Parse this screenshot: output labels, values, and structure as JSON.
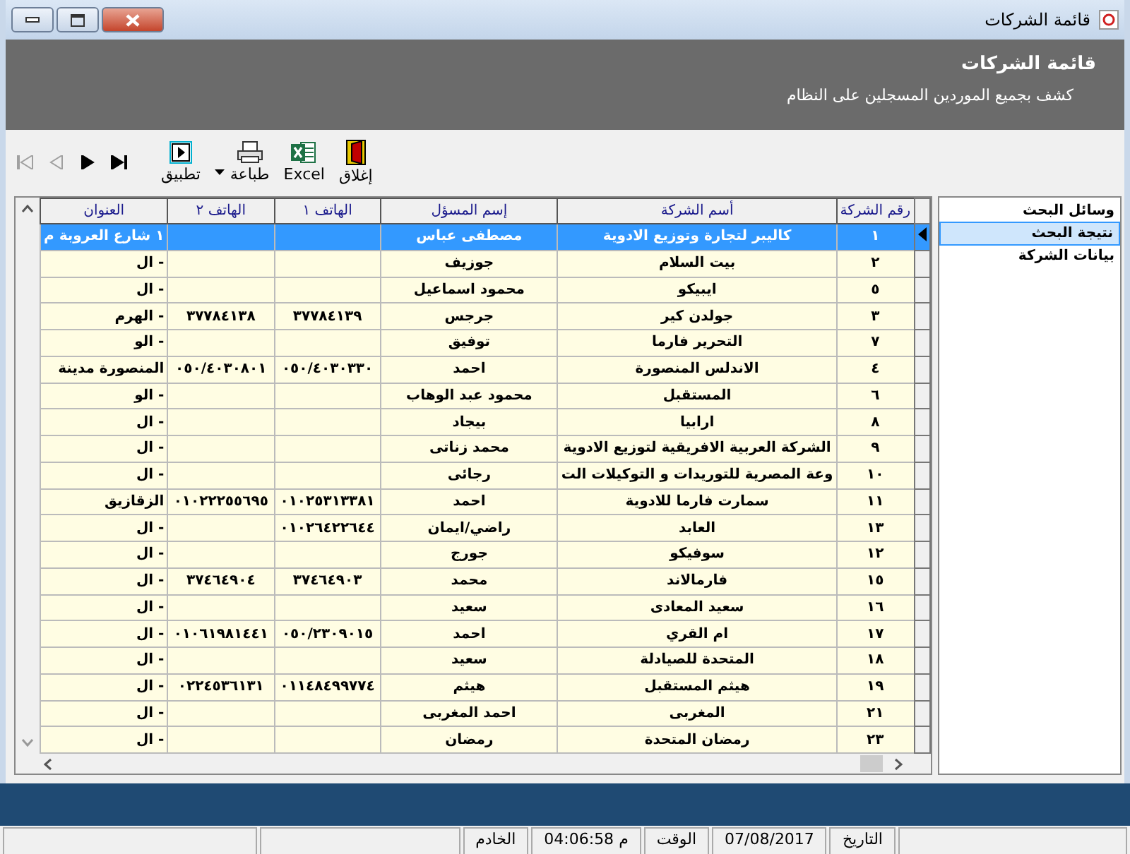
{
  "window": {
    "title": "قائمة الشركات"
  },
  "header": {
    "title": "قائمة الشركات",
    "subtitle": "كشف بجميع الموردين المسجلين على النظام"
  },
  "toolbar": {
    "nav": [
      {
        "kind": "first",
        "disabled": true
      },
      {
        "kind": "prev",
        "disabled": true
      },
      {
        "kind": "next",
        "disabled": false
      },
      {
        "kind": "last",
        "disabled": false
      }
    ],
    "buttons": [
      {
        "kind": "close",
        "label": "إغلاق"
      },
      {
        "kind": "excel",
        "label": "Excel"
      },
      {
        "kind": "print",
        "label": "طباعة"
      },
      {
        "kind": "apply",
        "label": "تطبيق"
      }
    ]
  },
  "sidebar": {
    "items": [
      {
        "label": "وسائل البحث",
        "selected": false
      },
      {
        "label": "نتيجة البحث",
        "selected": true
      },
      {
        "label": "بيانات الشركة",
        "selected": false
      }
    ]
  },
  "table": {
    "columns": [
      "رقم الشركة",
      "أسم الشركة",
      "إسم المسؤل",
      "الهاتف ١",
      "الهاتف ٢",
      "العنوان"
    ],
    "rows": [
      {
        "selected": true,
        "cells": [
          "١",
          "كاليبر لتجارة وتوزيع الادوية",
          "مصطفى عباس",
          "",
          "",
          "١ شارع العروبة م"
        ]
      },
      {
        "selected": false,
        "cells": [
          "٢",
          "بيت السلام",
          "جوزيف",
          "",
          "",
          "- ال"
        ]
      },
      {
        "selected": false,
        "cells": [
          "٥",
          "ايبيكو",
          "محمود اسماعيل",
          "",
          "",
          "- ال"
        ]
      },
      {
        "selected": false,
        "cells": [
          "٣",
          "جولدن كير",
          "جرجس",
          "٣٧٧٨٤١٣٩",
          "٣٧٧٨٤١٣٨",
          "- الهرم"
        ]
      },
      {
        "selected": false,
        "cells": [
          "٧",
          "التحرير فارما",
          "توفيق",
          "",
          "",
          "- الو"
        ]
      },
      {
        "selected": false,
        "cells": [
          "٤",
          "الاندلس المنصورة",
          "احمد",
          "٠٥٠/٤٠٣٠٣٣٠",
          "٠٥٠/٤٠٣٠٨٠١",
          "المنصورة مدينة"
        ]
      },
      {
        "selected": false,
        "cells": [
          "٦",
          "المستقبل",
          "محمود عبد الوهاب",
          "",
          "",
          "- الو"
        ]
      },
      {
        "selected": false,
        "cells": [
          "٨",
          "ارابيا",
          "بيجاد",
          "",
          "",
          "- ال"
        ]
      },
      {
        "selected": false,
        "cells": [
          "٩",
          "الشركة العربية الافريقية لتوزيع الادوية",
          "محمد زناتى",
          "",
          "",
          "- ال"
        ]
      },
      {
        "selected": false,
        "cells": [
          "١٠",
          "وعة المصرية للتوريدات و التوكيلات الت",
          "رجائى",
          "",
          "",
          "- ال"
        ]
      },
      {
        "selected": false,
        "cells": [
          "١١",
          "سمارت فارما للادوية",
          "احمد",
          "٠١٠٢٥٣١٣٣٨١",
          "٠١٠٢٢٢٥٥٦٩٥",
          "الزقازيق"
        ]
      },
      {
        "selected": false,
        "cells": [
          "١٣",
          "العابد",
          "راضي/ايمان",
          "٠١٠٢٦٤٢٢٦٤٤",
          "",
          "- ال"
        ]
      },
      {
        "selected": false,
        "cells": [
          "١٢",
          "سوفيكو",
          "جورج",
          "",
          "",
          "- ال"
        ]
      },
      {
        "selected": false,
        "cells": [
          "١٥",
          "فارمالاند",
          "محمد",
          "٣٧٤٦٤٩٠٣",
          "٣٧٤٦٤٩٠٤",
          "- ال"
        ]
      },
      {
        "selected": false,
        "cells": [
          "١٦",
          "سعيد المعادى",
          "سعيد",
          "",
          "",
          "- ال"
        ]
      },
      {
        "selected": false,
        "cells": [
          "١٧",
          "ام القري",
          "احمد",
          "٠٥٠/٢٣٠٩٠١٥",
          "٠١٠٦١٩٨١٤٤١",
          "- ال"
        ]
      },
      {
        "selected": false,
        "cells": [
          "١٨",
          "المتحدة للصيادلة",
          "سعيد",
          "",
          "",
          "- ال"
        ]
      },
      {
        "selected": false,
        "cells": [
          "١٩",
          "هيثم المستقبل",
          "هيثم",
          "٠١١٤٨٤٩٩٧٧٤",
          "٠٢٢٤٥٣٦١٣١",
          "- ال"
        ]
      },
      {
        "selected": false,
        "cells": [
          "٢١",
          "المغربى",
          "احمد المغربى",
          "",
          "",
          "- ال"
        ]
      },
      {
        "selected": false,
        "cells": [
          "٢٣",
          "رمضان المتحدة",
          "رمضان",
          "",
          "",
          "- ال"
        ]
      }
    ]
  },
  "status_bar": {
    "fields": [
      "التاريخ",
      "07/08/2017",
      "الوقت",
      "04:06:58 م",
      "الخادم"
    ]
  }
}
